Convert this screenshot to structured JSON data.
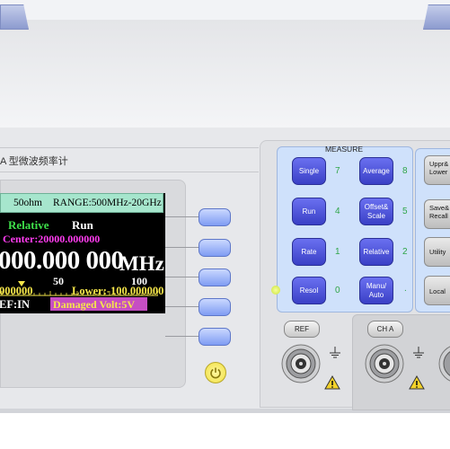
{
  "model": {
    "title_fragment": "A  型微波频率计"
  },
  "display": {
    "impedance": "50ohm",
    "range": "RANGE:500MHz-20GHz",
    "mode": "Relative",
    "state": "Run",
    "center": "Center:20000.000000",
    "reading": "000.000 000",
    "unit": "MHz",
    "scale_ticks": [
      "50",
      "100"
    ],
    "upper": "000000",
    "lower": "Lower:-100.000000",
    "ref": "EF:IN",
    "damaged": "Damaged Volt:5V"
  },
  "measure": {
    "title": "MEASURE",
    "buttons": [
      {
        "label": "Single",
        "num": "7"
      },
      {
        "label": "Average",
        "num": "8"
      },
      {
        "label": "Run",
        "num": "4"
      },
      {
        "label": "Offset& Scale",
        "num": "5"
      },
      {
        "label": "Rate",
        "num": "1"
      },
      {
        "label": "Relative",
        "num": "2"
      },
      {
        "label": "Resol",
        "num": "0"
      },
      {
        "label": "Manu/ Auto",
        "num": "."
      }
    ]
  },
  "side_buttons": [
    "Uppr& Lower",
    "Save& Recall",
    "Utility",
    "Local"
  ],
  "connectors": {
    "ref_label": "REF",
    "ch_label": "CH  A"
  },
  "colors": {
    "lcd_header": "#a6e6cd",
    "measure_button": "#4a50d8",
    "softkey": "#9db4f8",
    "reading_text": "#ffffff",
    "accent_green": "#3ee04a",
    "accent_magenta": "#ff3cf0",
    "accent_yellow": "#f5e64a"
  }
}
